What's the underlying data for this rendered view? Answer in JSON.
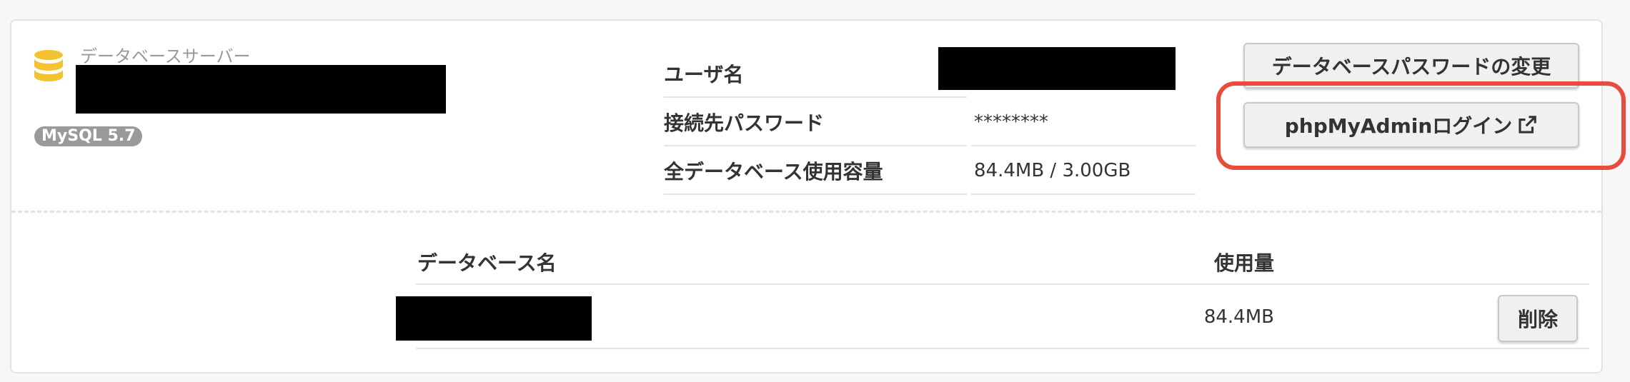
{
  "server": {
    "label": "データベースサーバー",
    "version": "MySQL 5.7",
    "icon": "database-icon",
    "icon_color": "#f4c430"
  },
  "info": {
    "rows": [
      {
        "label": "ユーザ名",
        "value": ""
      },
      {
        "label": "接続先パスワード",
        "value": "********"
      },
      {
        "label": "全データベース使用容量",
        "value": "84.4MB / 3.00GB"
      }
    ]
  },
  "actions": {
    "change_password": "データベースパスワードの変更",
    "phpmyadmin_login": "phpMyAdminログイン",
    "highlight_color": "#e74c3c"
  },
  "databases": {
    "columns": {
      "name": "データベース名",
      "usage": "使用量"
    },
    "rows": [
      {
        "name": "",
        "usage": "84.4MB",
        "delete_label": "削除"
      }
    ]
  }
}
